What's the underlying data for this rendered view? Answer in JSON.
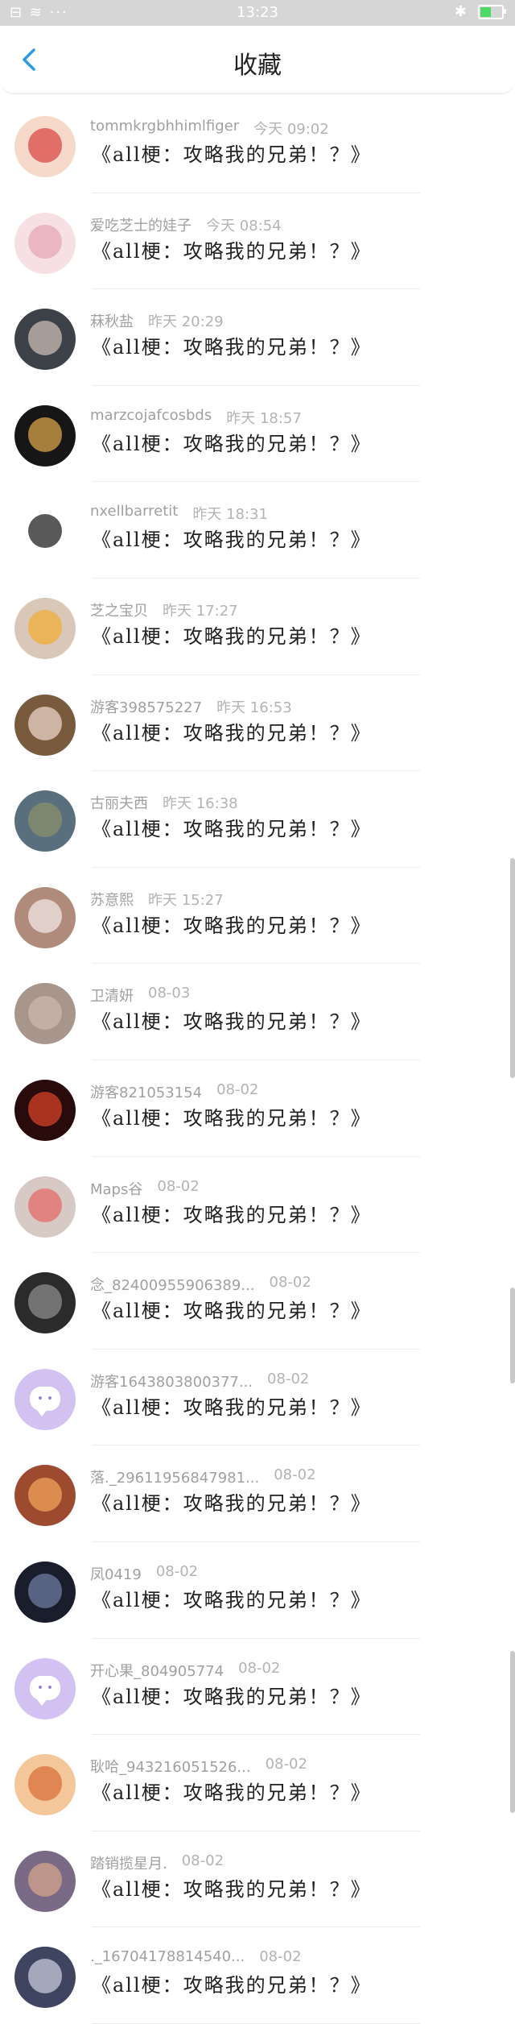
{
  "status_bar": {
    "time": "13:23",
    "left": "⊟ ≋ ···"
  },
  "nav": {
    "title": "收藏"
  },
  "items": [
    {
      "username": "tommkrgbhhimlfiger",
      "time": "今天 09:02",
      "title": "《all梗：攻略我的兄弟！？》",
      "avatar_color": "#f6d9c8",
      "avatar_accent": "#d94a4a"
    },
    {
      "username": "爱吃芝士的娃子",
      "time": "今天 08:54",
      "title": "《all梗：攻略我的兄弟！？》",
      "avatar_color": "#f7e0e4",
      "avatar_accent": "#e6a8b6"
    },
    {
      "username": "菻秋盐",
      "time": "昨天 20:29",
      "title": "《all梗：攻略我的兄弟！？》",
      "avatar_color": "#3d4148",
      "avatar_accent": "#c9bcb4"
    },
    {
      "username": "marzcojafcosbds",
      "time": "昨天 18:57",
      "title": "《all梗：攻略我的兄弟！？》",
      "avatar_color": "#161616",
      "avatar_accent": "#d8a34a"
    },
    {
      "username": "nxellbarretit",
      "time": "昨天 18:31",
      "title": "《all梗：攻略我的兄弟！？》",
      "avatar_color": "#ffffff",
      "avatar_accent": "#222222"
    },
    {
      "username": "芝之宝贝",
      "time": "昨天 17:27",
      "title": "《all梗：攻略我的兄弟！？》",
      "avatar_color": "#d9c7b8",
      "avatar_accent": "#f0ad38"
    },
    {
      "username": "游客398575227",
      "time": "昨天 16:53",
      "title": "《all梗：攻略我的兄弟！？》",
      "avatar_color": "#7a5a3c",
      "avatar_accent": "#e9d3c6"
    },
    {
      "username": "古丽夫西",
      "time": "昨天 16:38",
      "title": "《all梗：攻略我的兄弟！？》",
      "avatar_color": "#5a6f7d",
      "avatar_accent": "#8a8f6c"
    },
    {
      "username": "苏意熙",
      "time": "昨天 15:27",
      "title": "《all梗：攻略我的兄弟！？》",
      "avatar_color": "#b08a7a",
      "avatar_accent": "#f1e7e4"
    },
    {
      "username": "卫清妍",
      "time": "08-03",
      "title": "《all梗：攻略我的兄弟！？》",
      "avatar_color": "#a8958c",
      "avatar_accent": "#cbb8ae"
    },
    {
      "username": "游客821053154",
      "time": "08-02",
      "title": "《all梗：攻略我的兄弟！？》",
      "avatar_color": "#2a0b0b",
      "avatar_accent": "#d6402a"
    },
    {
      "username": "Maps谷",
      "time": "08-02",
      "title": "《all梗：攻略我的兄弟！？》",
      "avatar_color": "#d7c9c4",
      "avatar_accent": "#e36b6b"
    },
    {
      "username": "念_824009559063​89...",
      "time": "08-02",
      "title": "《all梗：攻略我的兄弟！？》",
      "avatar_color": "#2b2b2b",
      "avatar_accent": "#8c8c8c"
    },
    {
      "username": "游客1643803800377...",
      "time": "08-02",
      "title": "《all梗：攻略我的兄弟！？》",
      "avatar_type": "bubble",
      "avatar_color": "#d3c1f2",
      "avatar_accent": "#ffffff"
    },
    {
      "username": "落._29611956847981...",
      "time": "08-02",
      "title": "《all梗：攻略我的兄弟！？》",
      "avatar_color": "#9c4b2e",
      "avatar_accent": "#f0a15a"
    },
    {
      "username": "凤0419",
      "time": "08-02",
      "title": "《all梗：攻略我的兄弟！？》",
      "avatar_color": "#1a1d2b",
      "avatar_accent": "#6d7aa0"
    },
    {
      "username": "开心果_804905774",
      "time": "08-02",
      "title": "《all梗：攻略我的兄弟！？》",
      "avatar_type": "bubble",
      "avatar_color": "#d3c1f2",
      "avatar_accent": "#ffffff"
    },
    {
      "username": "耿哈_943216051526...",
      "time": "08-02",
      "title": "《all梗：攻略我的兄弟！？》",
      "avatar_color": "#f3c79a",
      "avatar_accent": "#d9703a"
    },
    {
      "username": "踏销揽星月.",
      "time": "08-02",
      "title": "《all梗：攻略我的兄弟！？》",
      "avatar_color": "#7a6a86",
      "avatar_accent": "#d5a48c"
    },
    {
      "username": "._16704178814540...",
      "time": "08-02",
      "title": "《all梗：攻略我的兄弟！？》",
      "avatar_color": "#3f4560",
      "avatar_accent": "#c6c9da"
    }
  ],
  "scrollbar": {
    "thumbs": [
      {
        "start": 0.0,
        "end": 0.23
      },
      {
        "start": 0.45,
        "end": 0.55
      },
      {
        "start": 0.83,
        "end": 1.0
      }
    ]
  }
}
